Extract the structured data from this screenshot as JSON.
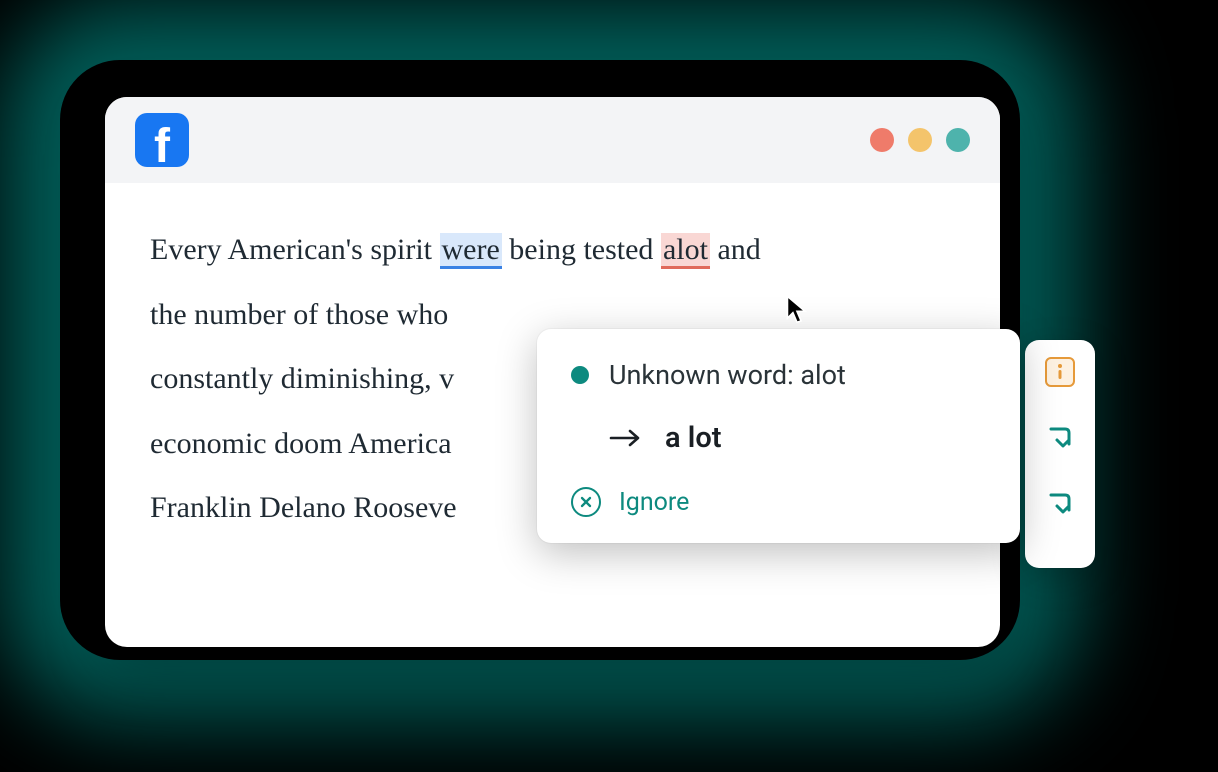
{
  "window": {
    "app_icon": "facebook-icon",
    "traffic_lights": [
      "red",
      "yellow",
      "teal"
    ]
  },
  "document": {
    "line1_pre": "Every American's spirit ",
    "line1_hl1": "were",
    "line1_mid": " being tested ",
    "line1_hl2": "alot",
    "line1_post": " and",
    "line2": "the number of those who",
    "line3": "constantly diminishing, v",
    "line4": "economic doom America",
    "line5": "Franklin Delano Rooseve"
  },
  "popup": {
    "title": "Unknown word: alot",
    "suggestion": "a lot",
    "ignore_label": "Ignore"
  },
  "sidebar": {
    "items": [
      "info",
      "next-down",
      "next-down"
    ]
  }
}
